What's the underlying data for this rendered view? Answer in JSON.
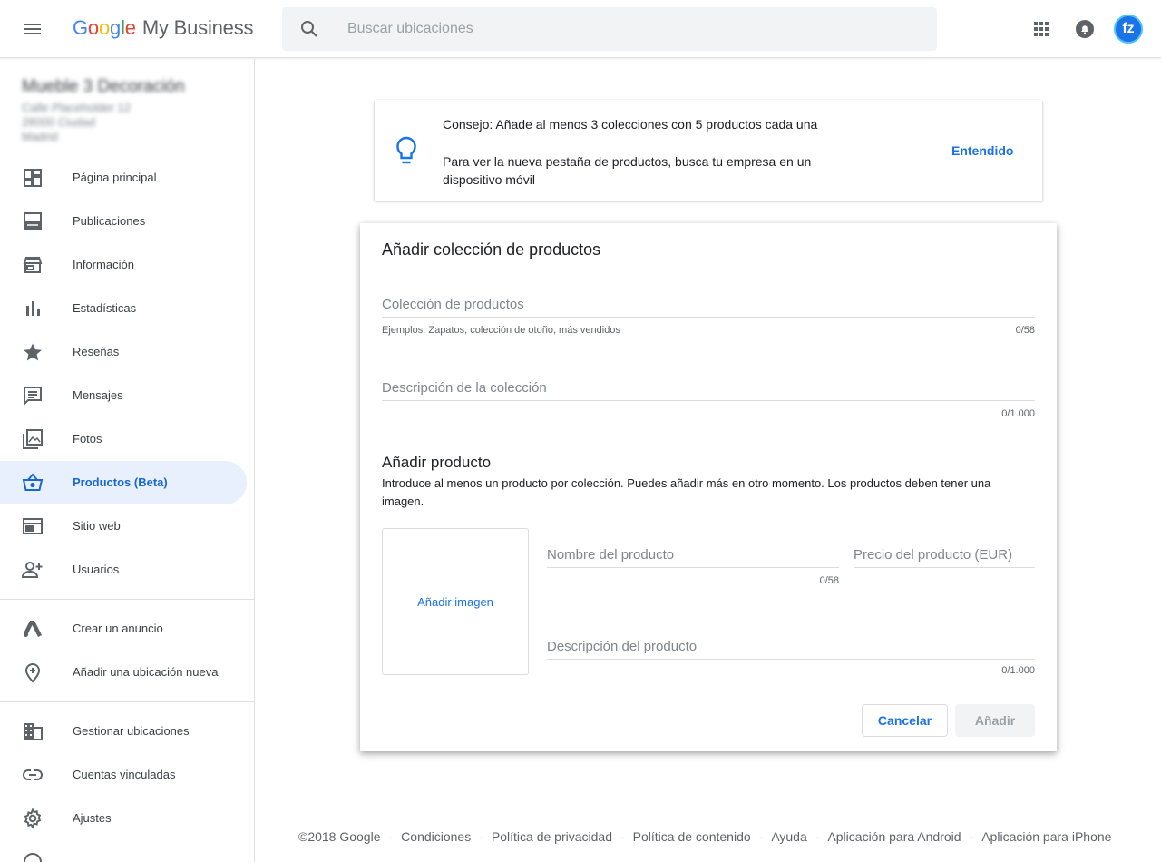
{
  "header": {
    "logo_google": [
      "G",
      "o",
      "o",
      "g",
      "l",
      "e"
    ],
    "logo_product": "My Business",
    "search_placeholder": "Buscar ubicaciones",
    "avatar_initial": "fz"
  },
  "sidebar": {
    "business_name": "Mueble 3 Decoración",
    "business_address": [
      "Calle Placeholder 12",
      "28000 Ciudad",
      "Madrid"
    ],
    "items": [
      {
        "label": "Página principal",
        "icon": "dashboard-icon"
      },
      {
        "label": "Publicaciones",
        "icon": "posts-icon"
      },
      {
        "label": "Información",
        "icon": "store-icon"
      },
      {
        "label": "Estadísticas",
        "icon": "bar-chart-icon"
      },
      {
        "label": "Reseñas",
        "icon": "star-icon"
      },
      {
        "label": "Mensajes",
        "icon": "message-icon"
      },
      {
        "label": "Fotos",
        "icon": "photos-icon"
      },
      {
        "label": "Productos (Beta)",
        "icon": "basket-icon",
        "active": true
      },
      {
        "label": "Sitio web",
        "icon": "web-icon"
      },
      {
        "label": "Usuarios",
        "icon": "add-user-icon"
      }
    ],
    "items2": [
      {
        "label": "Crear un anuncio",
        "icon": "ads-icon"
      },
      {
        "label": "Añadir una ubicación nueva",
        "icon": "add-location-icon"
      }
    ],
    "items3": [
      {
        "label": "Gestionar ubicaciones",
        "icon": "building-icon"
      },
      {
        "label": "Cuentas vinculadas",
        "icon": "link-icon"
      },
      {
        "label": "Ajustes",
        "icon": "settings-icon"
      }
    ]
  },
  "tip": {
    "title": "Consejo: Añade al menos 3 colecciones con 5 productos cada una",
    "body": "Para ver la nueva pestaña de productos, busca tu empresa en un dispositivo móvil",
    "button": "Entendido"
  },
  "dialog": {
    "title": "Añadir colección de productos",
    "collection_placeholder": "Colección de productos",
    "collection_hint": "Ejemplos: Zapatos, colección de otoño, más vendidos",
    "collection_count": "0/58",
    "description_placeholder": "Descripción de la colección",
    "description_count": "0/1.000",
    "product_section_title": "Añadir producto",
    "product_section_desc": "Introduce al menos un producto por colección. Puedes añadir más en otro momento. Los productos deben tener una imagen.",
    "add_image": "Añadir imagen",
    "product_name_placeholder": "Nombre del producto",
    "product_name_count": "0/58",
    "product_price_placeholder": "Precio del producto (EUR)",
    "product_desc_placeholder": "Descripción del producto",
    "product_desc_count": "0/1.000",
    "cancel": "Cancelar",
    "add": "Añadir"
  },
  "footer": {
    "links": [
      "©2018 Google",
      "Condiciones",
      "Política de privacidad",
      "Política de contenido",
      "Ayuda",
      "Aplicación para Android",
      "Aplicación para iPhone"
    ]
  }
}
